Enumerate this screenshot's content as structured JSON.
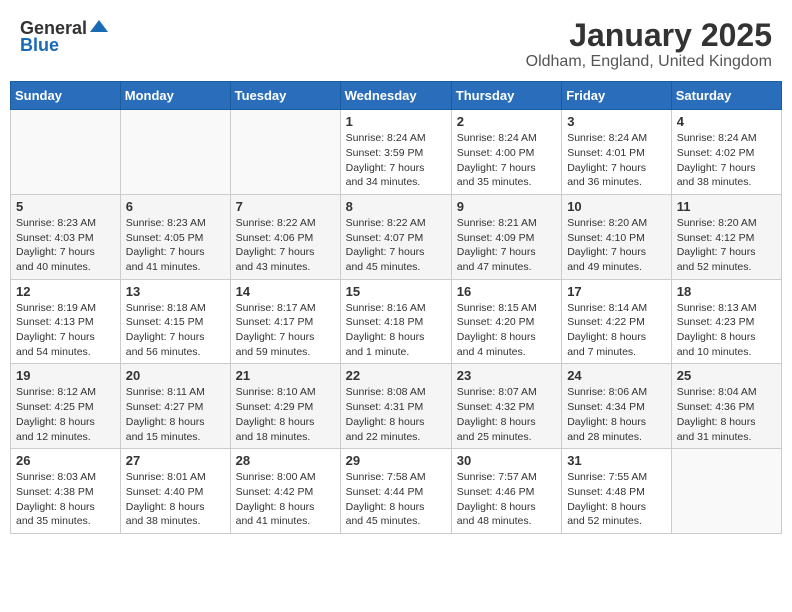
{
  "header": {
    "logo_general": "General",
    "logo_blue": "Blue",
    "month": "January 2025",
    "location": "Oldham, England, United Kingdom"
  },
  "weekdays": [
    "Sunday",
    "Monday",
    "Tuesday",
    "Wednesday",
    "Thursday",
    "Friday",
    "Saturday"
  ],
  "weeks": [
    [
      {
        "day": "",
        "info": ""
      },
      {
        "day": "",
        "info": ""
      },
      {
        "day": "",
        "info": ""
      },
      {
        "day": "1",
        "info": "Sunrise: 8:24 AM\nSunset: 3:59 PM\nDaylight: 7 hours\nand 34 minutes."
      },
      {
        "day": "2",
        "info": "Sunrise: 8:24 AM\nSunset: 4:00 PM\nDaylight: 7 hours\nand 35 minutes."
      },
      {
        "day": "3",
        "info": "Sunrise: 8:24 AM\nSunset: 4:01 PM\nDaylight: 7 hours\nand 36 minutes."
      },
      {
        "day": "4",
        "info": "Sunrise: 8:24 AM\nSunset: 4:02 PM\nDaylight: 7 hours\nand 38 minutes."
      }
    ],
    [
      {
        "day": "5",
        "info": "Sunrise: 8:23 AM\nSunset: 4:03 PM\nDaylight: 7 hours\nand 40 minutes."
      },
      {
        "day": "6",
        "info": "Sunrise: 8:23 AM\nSunset: 4:05 PM\nDaylight: 7 hours\nand 41 minutes."
      },
      {
        "day": "7",
        "info": "Sunrise: 8:22 AM\nSunset: 4:06 PM\nDaylight: 7 hours\nand 43 minutes."
      },
      {
        "day": "8",
        "info": "Sunrise: 8:22 AM\nSunset: 4:07 PM\nDaylight: 7 hours\nand 45 minutes."
      },
      {
        "day": "9",
        "info": "Sunrise: 8:21 AM\nSunset: 4:09 PM\nDaylight: 7 hours\nand 47 minutes."
      },
      {
        "day": "10",
        "info": "Sunrise: 8:20 AM\nSunset: 4:10 PM\nDaylight: 7 hours\nand 49 minutes."
      },
      {
        "day": "11",
        "info": "Sunrise: 8:20 AM\nSunset: 4:12 PM\nDaylight: 7 hours\nand 52 minutes."
      }
    ],
    [
      {
        "day": "12",
        "info": "Sunrise: 8:19 AM\nSunset: 4:13 PM\nDaylight: 7 hours\nand 54 minutes."
      },
      {
        "day": "13",
        "info": "Sunrise: 8:18 AM\nSunset: 4:15 PM\nDaylight: 7 hours\nand 56 minutes."
      },
      {
        "day": "14",
        "info": "Sunrise: 8:17 AM\nSunset: 4:17 PM\nDaylight: 7 hours\nand 59 minutes."
      },
      {
        "day": "15",
        "info": "Sunrise: 8:16 AM\nSunset: 4:18 PM\nDaylight: 8 hours\nand 1 minute."
      },
      {
        "day": "16",
        "info": "Sunrise: 8:15 AM\nSunset: 4:20 PM\nDaylight: 8 hours\nand 4 minutes."
      },
      {
        "day": "17",
        "info": "Sunrise: 8:14 AM\nSunset: 4:22 PM\nDaylight: 8 hours\nand 7 minutes."
      },
      {
        "day": "18",
        "info": "Sunrise: 8:13 AM\nSunset: 4:23 PM\nDaylight: 8 hours\nand 10 minutes."
      }
    ],
    [
      {
        "day": "19",
        "info": "Sunrise: 8:12 AM\nSunset: 4:25 PM\nDaylight: 8 hours\nand 12 minutes."
      },
      {
        "day": "20",
        "info": "Sunrise: 8:11 AM\nSunset: 4:27 PM\nDaylight: 8 hours\nand 15 minutes."
      },
      {
        "day": "21",
        "info": "Sunrise: 8:10 AM\nSunset: 4:29 PM\nDaylight: 8 hours\nand 18 minutes."
      },
      {
        "day": "22",
        "info": "Sunrise: 8:08 AM\nSunset: 4:31 PM\nDaylight: 8 hours\nand 22 minutes."
      },
      {
        "day": "23",
        "info": "Sunrise: 8:07 AM\nSunset: 4:32 PM\nDaylight: 8 hours\nand 25 minutes."
      },
      {
        "day": "24",
        "info": "Sunrise: 8:06 AM\nSunset: 4:34 PM\nDaylight: 8 hours\nand 28 minutes."
      },
      {
        "day": "25",
        "info": "Sunrise: 8:04 AM\nSunset: 4:36 PM\nDaylight: 8 hours\nand 31 minutes."
      }
    ],
    [
      {
        "day": "26",
        "info": "Sunrise: 8:03 AM\nSunset: 4:38 PM\nDaylight: 8 hours\nand 35 minutes."
      },
      {
        "day": "27",
        "info": "Sunrise: 8:01 AM\nSunset: 4:40 PM\nDaylight: 8 hours\nand 38 minutes."
      },
      {
        "day": "28",
        "info": "Sunrise: 8:00 AM\nSunset: 4:42 PM\nDaylight: 8 hours\nand 41 minutes."
      },
      {
        "day": "29",
        "info": "Sunrise: 7:58 AM\nSunset: 4:44 PM\nDaylight: 8 hours\nand 45 minutes."
      },
      {
        "day": "30",
        "info": "Sunrise: 7:57 AM\nSunset: 4:46 PM\nDaylight: 8 hours\nand 48 minutes."
      },
      {
        "day": "31",
        "info": "Sunrise: 7:55 AM\nSunset: 4:48 PM\nDaylight: 8 hours\nand 52 minutes."
      },
      {
        "day": "",
        "info": ""
      }
    ]
  ]
}
